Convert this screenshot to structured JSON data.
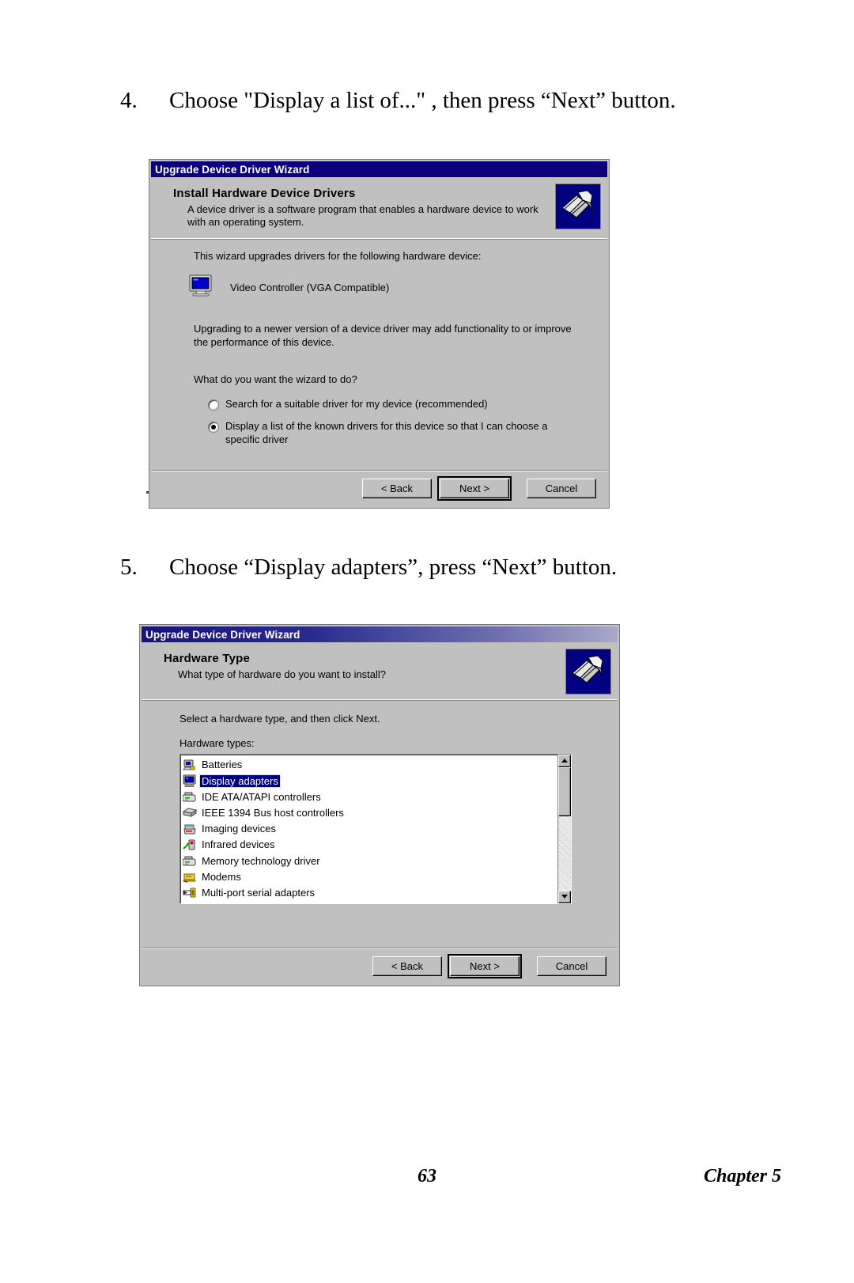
{
  "page": {
    "number": "63",
    "chapter": "Chapter 5"
  },
  "steps": [
    {
      "number": "4.",
      "text": "Choose \"Display a list of...\" , then press “Next” button."
    },
    {
      "number": "5.",
      "text": "Choose “Display adapters”, press “Next” button."
    }
  ],
  "dialog1": {
    "title": "Upgrade Device Driver Wizard",
    "header_title": "Install Hardware Device Drivers",
    "header_sub": "A device driver is a software program that enables a hardware device to work with an operating system.",
    "intro": "This wizard upgrades drivers for the following hardware device:",
    "device_name": "Video Controller (VGA Compatible)",
    "paragraph": "Upgrading to a newer version of a device driver may add functionality to or improve the performance of this device.",
    "question": "What do you want the wizard to do?",
    "options": [
      {
        "label": "Search for a suitable driver for my device (recommended)",
        "selected": false
      },
      {
        "label": "Display a list of the known drivers for this device so that I can choose a specific driver",
        "selected": true
      }
    ],
    "buttons": {
      "back": "< Back",
      "next": "Next >",
      "cancel": "Cancel"
    },
    "icons": {
      "wizard": "wizard-gears-icon",
      "device": "monitor-icon"
    }
  },
  "dialog2": {
    "title": "Upgrade Device Driver Wizard",
    "header_title": "Hardware Type",
    "header_sub": "What type of hardware do you want to install?",
    "instruction": "Select a hardware type, and then click Next.",
    "list_label": "Hardware types:",
    "items": [
      {
        "label": "Batteries",
        "icon": "battery-icon",
        "selected": false
      },
      {
        "label": "Display adapters",
        "icon": "monitor-icon",
        "selected": true
      },
      {
        "label": "IDE ATA/ATAPI controllers",
        "icon": "controller-icon",
        "selected": false
      },
      {
        "label": "IEEE 1394 Bus host controllers",
        "icon": "firewire-icon",
        "selected": false
      },
      {
        "label": "Imaging devices",
        "icon": "scanner-icon",
        "selected": false
      },
      {
        "label": "Infrared devices",
        "icon": "infrared-icon",
        "selected": false
      },
      {
        "label": "Memory technology driver",
        "icon": "controller-icon",
        "selected": false
      },
      {
        "label": "Modems",
        "icon": "modem-icon",
        "selected": false
      },
      {
        "label": "Multi-port serial adapters",
        "icon": "serial-adapter-icon",
        "selected": false
      }
    ],
    "buttons": {
      "back": "< Back",
      "next": "Next >",
      "cancel": "Cancel"
    },
    "icons": {
      "wizard": "wizard-gears-icon",
      "scroll_up": "scroll-up-arrow-icon",
      "scroll_down": "scroll-down-arrow-icon"
    }
  },
  "colors": {
    "titlebar_blue": "#0a007c",
    "dialog_face": "#c0c0c0",
    "selection_blue": "#000080"
  }
}
